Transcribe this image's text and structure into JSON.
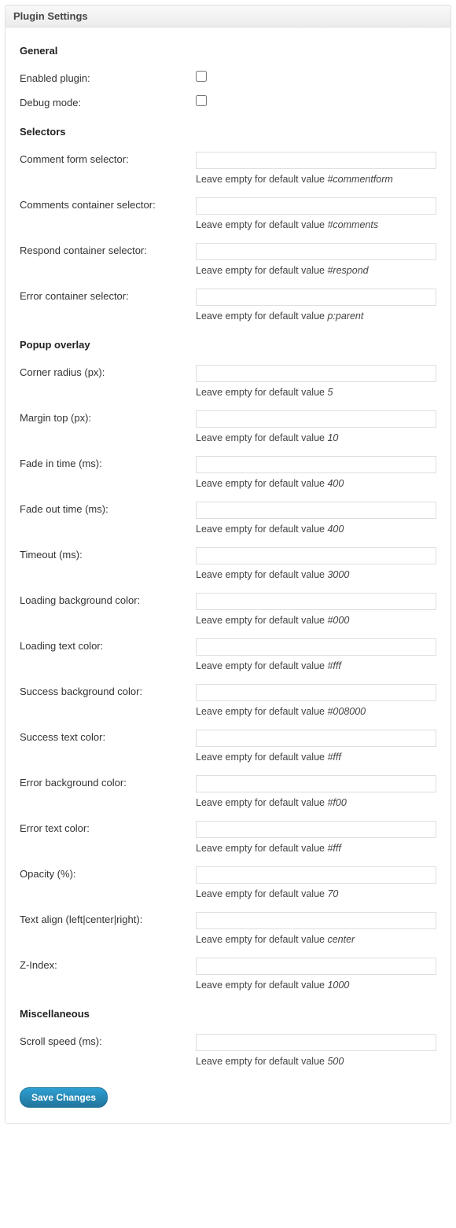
{
  "panel": {
    "title": "Plugin Settings"
  },
  "hint_prefix": "Leave empty for default value ",
  "sections": {
    "general": {
      "title": "General",
      "enabled_plugin_label": "Enabled plugin:",
      "debug_mode_label": "Debug mode:"
    },
    "selectors": {
      "title": "Selectors",
      "comment_form": {
        "label": "Comment form selector:",
        "value": "",
        "default": "#commentform"
      },
      "comments_container": {
        "label": "Comments container selector:",
        "value": "",
        "default": "#comments"
      },
      "respond_container": {
        "label": "Respond container selector:",
        "value": "",
        "default": "#respond"
      },
      "error_container": {
        "label": "Error container selector:",
        "value": "",
        "default": "p:parent"
      }
    },
    "popup": {
      "title": "Popup overlay",
      "corner_radius": {
        "label": "Corner radius (px):",
        "value": "",
        "default": "5"
      },
      "margin_top": {
        "label": "Margin top (px):",
        "value": "",
        "default": "10"
      },
      "fade_in": {
        "label": "Fade in time (ms):",
        "value": "",
        "default": "400"
      },
      "fade_out": {
        "label": "Fade out time (ms):",
        "value": "",
        "default": "400"
      },
      "timeout": {
        "label": "Timeout (ms):",
        "value": "",
        "default": "3000"
      },
      "loading_bg": {
        "label": "Loading background color:",
        "value": "",
        "default": "#000"
      },
      "loading_text": {
        "label": "Loading text color:",
        "value": "",
        "default": "#fff"
      },
      "success_bg": {
        "label": "Success background color:",
        "value": "",
        "default": "#008000"
      },
      "success_text": {
        "label": "Success text color:",
        "value": "",
        "default": "#fff"
      },
      "error_bg": {
        "label": "Error background color:",
        "value": "",
        "default": "#f00"
      },
      "error_text": {
        "label": "Error text color:",
        "value": "",
        "default": "#fff"
      },
      "opacity": {
        "label": "Opacity (%):",
        "value": "",
        "default": "70"
      },
      "text_align": {
        "label": "Text align (left|center|right):",
        "value": "",
        "default": "center"
      },
      "z_index": {
        "label": "Z-Index:",
        "value": "",
        "default": "1000"
      }
    },
    "misc": {
      "title": "Miscellaneous",
      "scroll_speed": {
        "label": "Scroll speed (ms):",
        "value": "",
        "default": "500"
      }
    }
  },
  "submit": {
    "label": "Save Changes"
  }
}
